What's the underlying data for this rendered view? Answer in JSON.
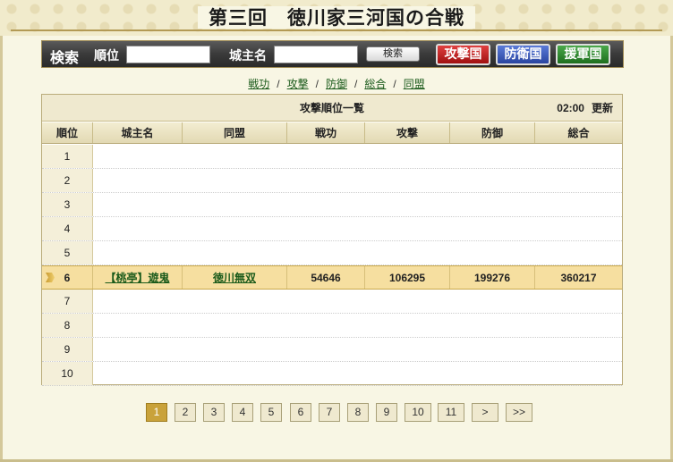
{
  "page": {
    "title": "第三回　徳川家三河国の合戦"
  },
  "search": {
    "label": "検索",
    "rank_label": "順位",
    "rank_value": "",
    "lord_label": "城主名",
    "lord_value": "",
    "search_button": "検索",
    "attack_button": "攻撃国",
    "defense_button": "防衛国",
    "support_button": "援軍国"
  },
  "sort_links": [
    "戦功",
    "攻撃",
    "防御",
    "総合",
    "同盟"
  ],
  "table": {
    "title": "攻撃順位一覧",
    "time": "02:00",
    "update_label": "更新",
    "headers": [
      "順位",
      "城主名",
      "同盟",
      "戦功",
      "攻撃",
      "防御",
      "総合"
    ],
    "rows": [
      {
        "rank": "1",
        "lord": "",
        "alliance": "",
        "merit": "",
        "attack": "",
        "defense": "",
        "total": ""
      },
      {
        "rank": "2",
        "lord": "",
        "alliance": "",
        "merit": "",
        "attack": "",
        "defense": "",
        "total": ""
      },
      {
        "rank": "3",
        "lord": "",
        "alliance": "",
        "merit": "",
        "attack": "",
        "defense": "",
        "total": ""
      },
      {
        "rank": "4",
        "lord": "",
        "alliance": "",
        "merit": "",
        "attack": "",
        "defense": "",
        "total": ""
      },
      {
        "rank": "5",
        "lord": "",
        "alliance": "",
        "merit": "",
        "attack": "",
        "defense": "",
        "total": ""
      },
      {
        "rank": "6",
        "lord": "【桃亭】遊鬼",
        "alliance": "徳川無双",
        "merit": "54646",
        "attack": "106295",
        "defense": "199276",
        "total": "360217"
      },
      {
        "rank": "7",
        "lord": "",
        "alliance": "",
        "merit": "",
        "attack": "",
        "defense": "",
        "total": ""
      },
      {
        "rank": "8",
        "lord": "",
        "alliance": "",
        "merit": "",
        "attack": "",
        "defense": "",
        "total": ""
      },
      {
        "rank": "9",
        "lord": "",
        "alliance": "",
        "merit": "",
        "attack": "",
        "defense": "",
        "total": ""
      },
      {
        "rank": "10",
        "lord": "",
        "alliance": "",
        "merit": "",
        "attack": "",
        "defense": "",
        "total": ""
      }
    ],
    "highlight_row": 5
  },
  "pagination": {
    "pages": [
      "1",
      "2",
      "3",
      "4",
      "5",
      "6",
      "7",
      "8",
      "9",
      "10",
      "11"
    ],
    "active": "1",
    "next": ">",
    "last": ">>"
  },
  "colors": {
    "accent": "#c9a23a",
    "highlight": "#f6dfa0",
    "link": "#1a5a1a"
  }
}
